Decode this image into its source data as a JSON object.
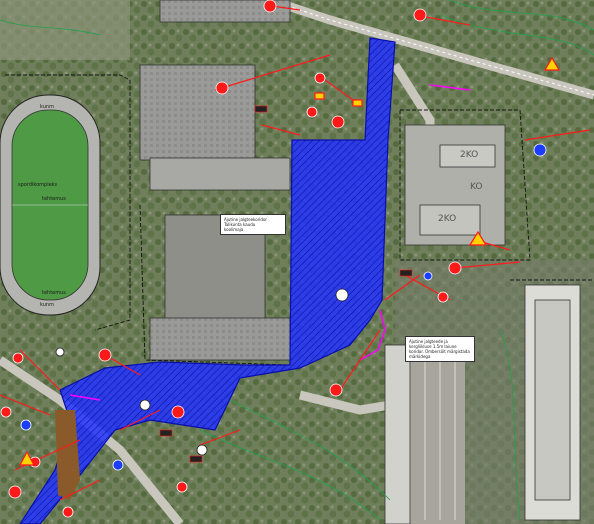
{
  "map": {
    "colors": {
      "closure_zone": "#2233ff",
      "traffic_route": "#ff1a1a",
      "temporary_path": "#ff00ff",
      "stadium_field": "#4f9a45",
      "track": "#b8b8b8",
      "fence": "#111111",
      "contour": "#1fa14a"
    },
    "labels": {
      "stadium_top": "kunm",
      "stadium_mid1": "spordikompleks",
      "stadium_mid2": "tehtemus",
      "stadium_low": "tehtemus",
      "stadium_bottom": "kunm",
      "bldg_2ko": "2KO",
      "bldg_ko": "KO",
      "bldg_2ko_b": "2KO"
    },
    "notes": {
      "note_left": "Ajutine jalgteekoridor\nTalikunta kaudu\nkoolimaja",
      "note_right": "Ajutine jalgteede ja\nkergliikluse 1.5m laiune\nkoridor. Ümbersõit märgistada\nmärkidega"
    }
  }
}
